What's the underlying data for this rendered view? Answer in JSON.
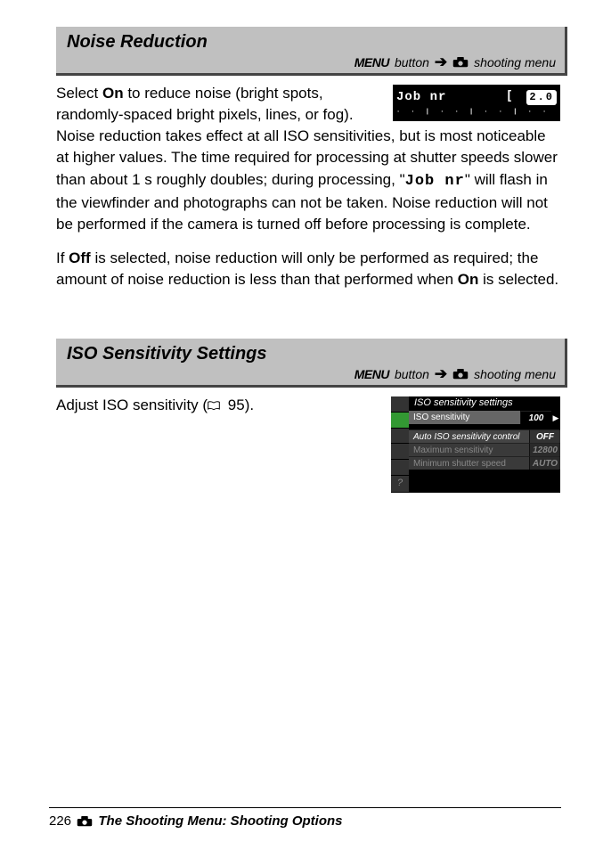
{
  "page_number": "226",
  "footer_title": "The Shooting Menu: Shooting Options",
  "sections": {
    "noise": {
      "title": "Noise Reduction",
      "menu_label": "MENU",
      "menu_button_word": "button",
      "menu_target": "shooting menu",
      "para1_a": "Select ",
      "para1_on": "On",
      "para1_b": " to reduce noise (bright spots, randomly-spaced bright pixels, lines, or fog). Noise reduction takes effect at all ISO sensitivities, but is most noticeable at higher values. The time required for processing at shutter speeds slower than about 1 s roughly doubles; during processing, \"",
      "para1_jobnr": "Job nr",
      "para1_c": "\" will flash in the viewfinder and photographs can not be taken. Noise reduction will not be performed if the camera is turned off before processing is complete.",
      "para2_a": "If ",
      "para2_off": "Off",
      "para2_b": " is selected, noise reduction will only be performed as required; the amount of noise reduction is less than that performed when ",
      "para2_on": "On",
      "para2_c": " is selected.",
      "vf_label": "Job nr",
      "vf_value": "2.0"
    },
    "iso": {
      "title": "ISO Sensitivity Settings",
      "menu_label": "MENU",
      "menu_button_word": "button",
      "menu_target": "shooting menu",
      "body_a": "Adjust ISO sensitivity (",
      "body_ref": "95",
      "body_b": ").",
      "lcd": {
        "title": "ISO sensitivity settings",
        "row1_label": "ISO sensitivity",
        "row1_value": "100",
        "row2_label": "Auto ISO sensitivity control",
        "row2_value": "OFF",
        "row3_label": "Maximum sensitivity",
        "row3_value": "12800",
        "row4_label": "Minimum shutter speed",
        "row4_value": "AUTO"
      }
    }
  }
}
